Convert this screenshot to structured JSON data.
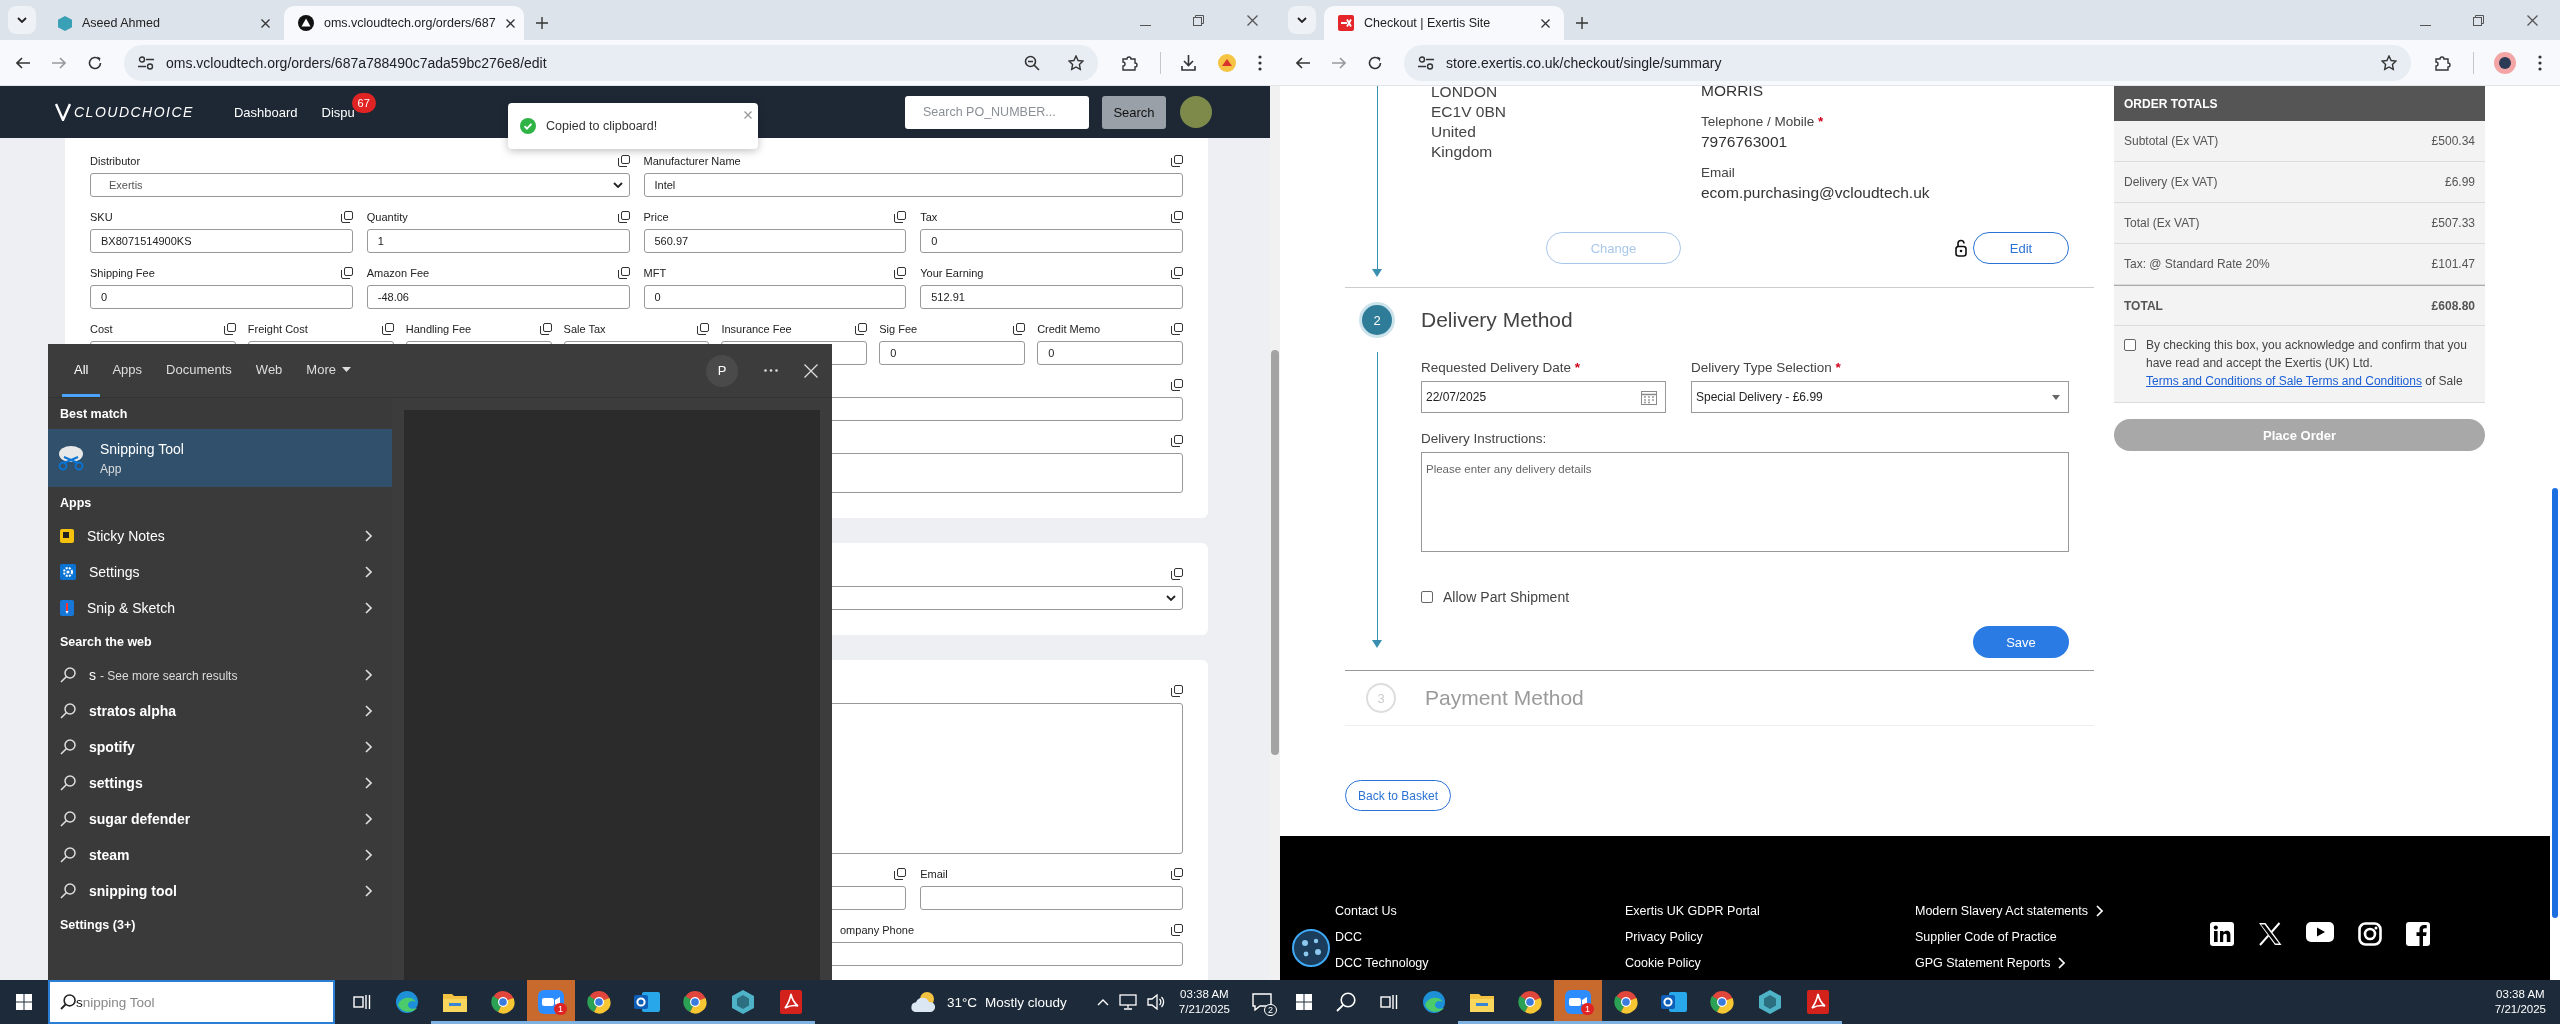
{
  "left_monitor": {
    "browser": {
      "tabs": [
        {
          "title": "Aseed Ahmed",
          "selected": false
        },
        {
          "title": "oms.vcloudtech.org/orders/687",
          "selected": true
        }
      ],
      "url": "oms.vcloudtech.org/orders/687a788490c7ada59bc276e8/edit"
    },
    "navbar": {
      "logo": "CLOUDCHOICE",
      "links": [
        {
          "label": "Dashboard"
        },
        {
          "label": "Dispu",
          "badge": "67"
        }
      ],
      "search_placeholder": "Search PO_NUMBER...",
      "search_button": "Search"
    },
    "toast": {
      "message": "Copied to clipboard!"
    },
    "cards": [
      {
        "rows": [
          [
            {
              "label": "Distributor",
              "kind": "select",
              "value": "Exertis"
            },
            {
              "kind": "continued"
            },
            {
              "label": "Manufacturer Name",
              "kind": "input",
              "value": "Intel"
            },
            {
              "kind": "continued"
            }
          ],
          [
            {
              "label": "SKU",
              "kind": "input",
              "value": "BX8071514900KS"
            },
            {
              "label": "Quantity",
              "kind": "input",
              "value": "1"
            },
            {
              "label": "Price",
              "kind": "input",
              "value": "560.97"
            },
            {
              "label": "Tax",
              "kind": "input",
              "value": "0"
            }
          ],
          [
            {
              "label": "Shipping Fee",
              "kind": "input",
              "value": "0"
            },
            {
              "label": "Amazon Fee",
              "kind": "input",
              "value": "-48.06"
            },
            {
              "label": "MFT",
              "kind": "input",
              "value": "0"
            },
            {
              "label": "Your Earning",
              "kind": "input",
              "value": "512.91"
            }
          ],
          [
            {
              "label": "Cost",
              "kind": "input"
            },
            {
              "label": "Freight Cost",
              "kind": "input"
            },
            {
              "label": "Handling Fee",
              "kind": "input"
            },
            {
              "label": "Sale Tax",
              "kind": "input"
            },
            {
              "label": "Insurance Fee",
              "kind": "input"
            },
            {
              "label": "Sig Fee",
              "kind": "input",
              "value": "0"
            },
            {
              "label": "Credit Memo",
              "kind": "input",
              "value": "0"
            }
          ],
          [
            {
              "kind": "input"
            }
          ],
          [
            {
              "kind": "textarea"
            }
          ]
        ]
      },
      {
        "rows": [
          [
            {
              "kind": "select"
            }
          ]
        ]
      },
      {
        "rows": [
          [
            {
              "kind": "textarea"
            }
          ],
          [
            {
              "kind": "blank"
            },
            {
              "kind": "blank"
            },
            {
              "kind": "input"
            },
            {
              "label": "Email",
              "kind": "input"
            }
          ],
          [
            {
              "kind": "blank"
            },
            {
              "kind": "blank"
            },
            {
              "label": "ompany Phone",
              "kind": "input"
            }
          ]
        ]
      }
    ],
    "start_menu": {
      "tabs": [
        {
          "label": "All",
          "selected": true
        },
        {
          "label": "Apps",
          "selected": false
        },
        {
          "label": "Documents",
          "selected": false
        },
        {
          "label": "Web",
          "selected": false
        },
        {
          "label": "More",
          "selected": false,
          "dropdown": true
        }
      ],
      "account_initial": "P",
      "sections": [
        {
          "heading": "Best match",
          "items": [
            {
              "kind": "best",
              "title": "Snipping Tool",
              "subtitle": "App",
              "selected": true
            }
          ]
        },
        {
          "heading": "Apps",
          "items": [
            {
              "kind": "app",
              "title": "Sticky Notes",
              "selected": false
            },
            {
              "kind": "app",
              "title": "Settings",
              "selected": false
            },
            {
              "kind": "app",
              "title": "Snip & Sketch",
              "selected": false
            }
          ]
        },
        {
          "heading": "Search the web",
          "items": [
            {
              "kind": "web",
              "title": "s",
              "subtitle": "- See more search results",
              "selected": false
            },
            {
              "kind": "web",
              "title": "stratos alpha",
              "selected": false
            },
            {
              "kind": "web",
              "title": "spotify",
              "selected": false
            },
            {
              "kind": "web",
              "title": "settings",
              "selected": false
            },
            {
              "kind": "web",
              "title": "sugar defender",
              "selected": false
            },
            {
              "kind": "web",
              "title": "steam",
              "selected": false
            },
            {
              "kind": "web",
              "title": "snipping tool",
              "selected": false
            }
          ]
        },
        {
          "heading": "Settings (3+)"
        }
      ]
    }
  },
  "right_monitor": {
    "browser": {
      "tabs": [
        {
          "title": "Checkout | Exertis Site",
          "selected": true
        }
      ],
      "url": "store.exertis.co.uk/checkout/single/summary"
    },
    "checkout": {
      "address_lines": [
        "LONDON",
        "EC1V 0BN",
        "United",
        "Kingdom"
      ],
      "contact": [
        {
          "value": "MORRIS"
        },
        {
          "label": "Telephone / Mobile",
          "required_mark": "*",
          "value": "7976763001"
        },
        {
          "label": "Email",
          "value": "ecom.purchasing@vcloudtech.uk"
        }
      ],
      "change_button": {
        "label": "Change",
        "disabled": true
      },
      "edit_button": {
        "label": "Edit"
      },
      "delivery_step": {
        "number": "2",
        "title": "Delivery Method",
        "active": true
      },
      "delivery_date": {
        "label": "Requested Delivery Date",
        "required_mark": "*",
        "value": "22/07/2025"
      },
      "delivery_type": {
        "label": "Delivery Type Selection",
        "required_mark": "*",
        "value": "Special Delivery - £6.99"
      },
      "instructions": {
        "label": "Delivery Instructions:",
        "placeholder": "Please enter any delivery details"
      },
      "part_shipment": {
        "label": "Allow Part Shipment",
        "checked": false
      },
      "save_button": {
        "label": "Save"
      },
      "payment_step": {
        "number": "3",
        "title": "Payment Method",
        "active": false
      },
      "back_button": {
        "label": "Back to Basket"
      }
    },
    "order_totals": {
      "title": "ORDER TOTALS",
      "rows": [
        {
          "kind": "line",
          "label": "Subtotal (Ex VAT)",
          "value": "£500.34"
        },
        {
          "kind": "line",
          "label": "Delivery (Ex VAT)",
          "value": "£6.99"
        },
        {
          "kind": "line",
          "label": "Total (Ex VAT)",
          "value": "£507.33"
        },
        {
          "kind": "line",
          "label": "Tax: @ Standard Rate 20%",
          "value": "£101.47"
        },
        {
          "kind": "total",
          "label": "TOTAL",
          "value": "£608.80"
        }
      ],
      "consent": {
        "checked": false,
        "text": "By checking this box, you acknowledge and confirm that you have read and accept the Exertis (UK) Ltd.",
        "link": "Terms and Conditions of Sale Terms and Conditions",
        "after": "of Sale"
      },
      "place_order": {
        "label": "Place Order",
        "disabled": true
      }
    },
    "footer": {
      "columns": [
        [
          {
            "label": "Contact Us",
            "arrow": false
          },
          {
            "label": "DCC",
            "arrow": false
          },
          {
            "label": "DCC Technology",
            "arrow": false
          }
        ],
        [
          {
            "label": "Exertis UK GDPR Portal",
            "arrow": false
          },
          {
            "label": "Privacy Policy",
            "arrow": false
          },
          {
            "label": "Cookie Policy",
            "arrow": false
          }
        ],
        [
          {
            "label": "Modern Slavery Act statements",
            "arrow": true
          },
          {
            "label": "Supplier Code of Practice",
            "arrow": false
          },
          {
            "label": "GPG Statement Reports",
            "arrow": true
          }
        ]
      ]
    }
  },
  "taskbar": {
    "left": {
      "search": {
        "value": "s",
        "suggestion": "nipping Tool"
      },
      "apps": [
        {
          "running": false,
          "active": false
        },
        {
          "running": true,
          "active": false
        },
        {
          "running": true,
          "active": false
        },
        {
          "running": true,
          "active": true,
          "badge": "1"
        },
        {
          "running": true,
          "active": false
        },
        {
          "running": true,
          "active": false
        },
        {
          "running": true,
          "active": false
        },
        {
          "running": true,
          "active": false
        },
        {
          "running": true,
          "active": false
        }
      ],
      "weather": {
        "temperature": "31°C",
        "condition": "Mostly cloudy"
      },
      "time": "03:38 AM",
      "date": "7/21/2025",
      "notification_count": "2"
    },
    "right": {
      "apps": [
        {
          "running": false,
          "active": false
        },
        {
          "running": true,
          "active": false
        },
        {
          "running": true,
          "active": false
        },
        {
          "running": true,
          "active": true,
          "badge": "1"
        },
        {
          "running": true,
          "active": false
        },
        {
          "running": true,
          "active": false
        },
        {
          "running": true,
          "active": false
        },
        {
          "running": true,
          "active": false
        },
        {
          "running": true,
          "active": false
        }
      ],
      "time": "03:38 AM",
      "date": "7/21/2025"
    }
  }
}
